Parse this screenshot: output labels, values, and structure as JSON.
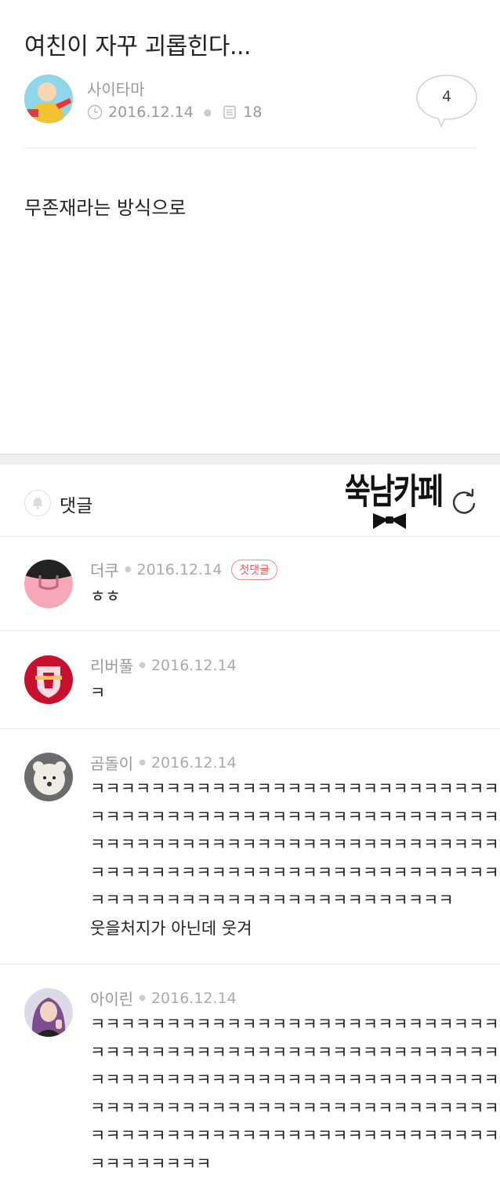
{
  "post": {
    "title": "여친이 자꾸 괴롭힌다...",
    "author": "사이타마",
    "date": "2016.12.14",
    "views": "18",
    "comment_count": "4",
    "body": "무존재라는 방식으로"
  },
  "comments_section": {
    "label": "댓글",
    "logo_text": "쑥남카페"
  },
  "comments": [
    {
      "name": "더쿠",
      "date": "2016.12.14",
      "badge": "첫댓글",
      "text": "ㅎㅎ"
    },
    {
      "name": "리버풀",
      "date": "2016.12.14",
      "text": "ㅋ"
    },
    {
      "name": "곰돌이",
      "date": "2016.12.14",
      "text": "ㅋㅋㅋㅋㅋㅋㅋㅋㅋㅋㅋㅋㅋㅋㅋㅋㅋㅋㅋㅋㅋㅋㅋㅋㅋㅋㅋ\nㅋㅋㅋㅋㅋㅋㅋㅋㅋㅋㅋㅋㅋㅋㅋㅋㅋㅋㅋㅋㅋㅋㅋㅋㅋㅋㅋ\nㅋㅋㅋㅋㅋㅋㅋㅋㅋㅋㅋㅋㅋㅋㅋㅋㅋㅋㅋㅋㅋㅋㅋㅋㅋㅋㅋ\nㅋㅋㅋㅋㅋㅋㅋㅋㅋㅋㅋㅋㅋㅋㅋㅋㅋㅋㅋㅋㅋㅋㅋㅋㅋㅋㅋ\nㅋㅋㅋㅋㅋㅋㅋㅋㅋㅋㅋㅋㅋㅋㅋㅋㅋㅋㅋㅋㅋㅋㅋㅋ\n웃을처지가 아닌데 웃겨"
    },
    {
      "name": "아이린",
      "date": "2016.12.14",
      "text": "ㅋㅋㅋㅋㅋㅋㅋㅋㅋㅋㅋㅋㅋㅋㅋㅋㅋㅋㅋㅋㅋㅋㅋㅋㅋㅋㅋ\nㅋㅋㅋㅋㅋㅋㅋㅋㅋㅋㅋㅋㅋㅋㅋㅋㅋㅋㅋㅋㅋㅋㅋㅋㅋㅋㅋ\nㅋㅋㅋㅋㅋㅋㅋㅋㅋㅋㅋㅋㅋㅋㅋㅋㅋㅋㅋㅋㅋㅋㅋㅋㅋㅋㅋ\nㅋㅋㅋㅋㅋㅋㅋㅋㅋㅋㅋㅋㅋㅋㅋㅋㅋㅋㅋㅋㅋㅋㅋㅋㅋㅋㅋ\nㅋㅋㅋㅋㅋㅋㅋㅋㅋㅋㅋㅋㅋㅋㅋㅋㅋㅋㅋㅋㅋㅋㅋㅋㅋㅋㅋ\nㅋㅋㅋㅋㅋㅋㅋㅋ"
    }
  ],
  "icons": {
    "clock": "clock-icon",
    "views": "document-icon",
    "bell": "bell-icon",
    "refresh": "refresh-icon",
    "comment_bubble": "speech-bubble-icon"
  }
}
